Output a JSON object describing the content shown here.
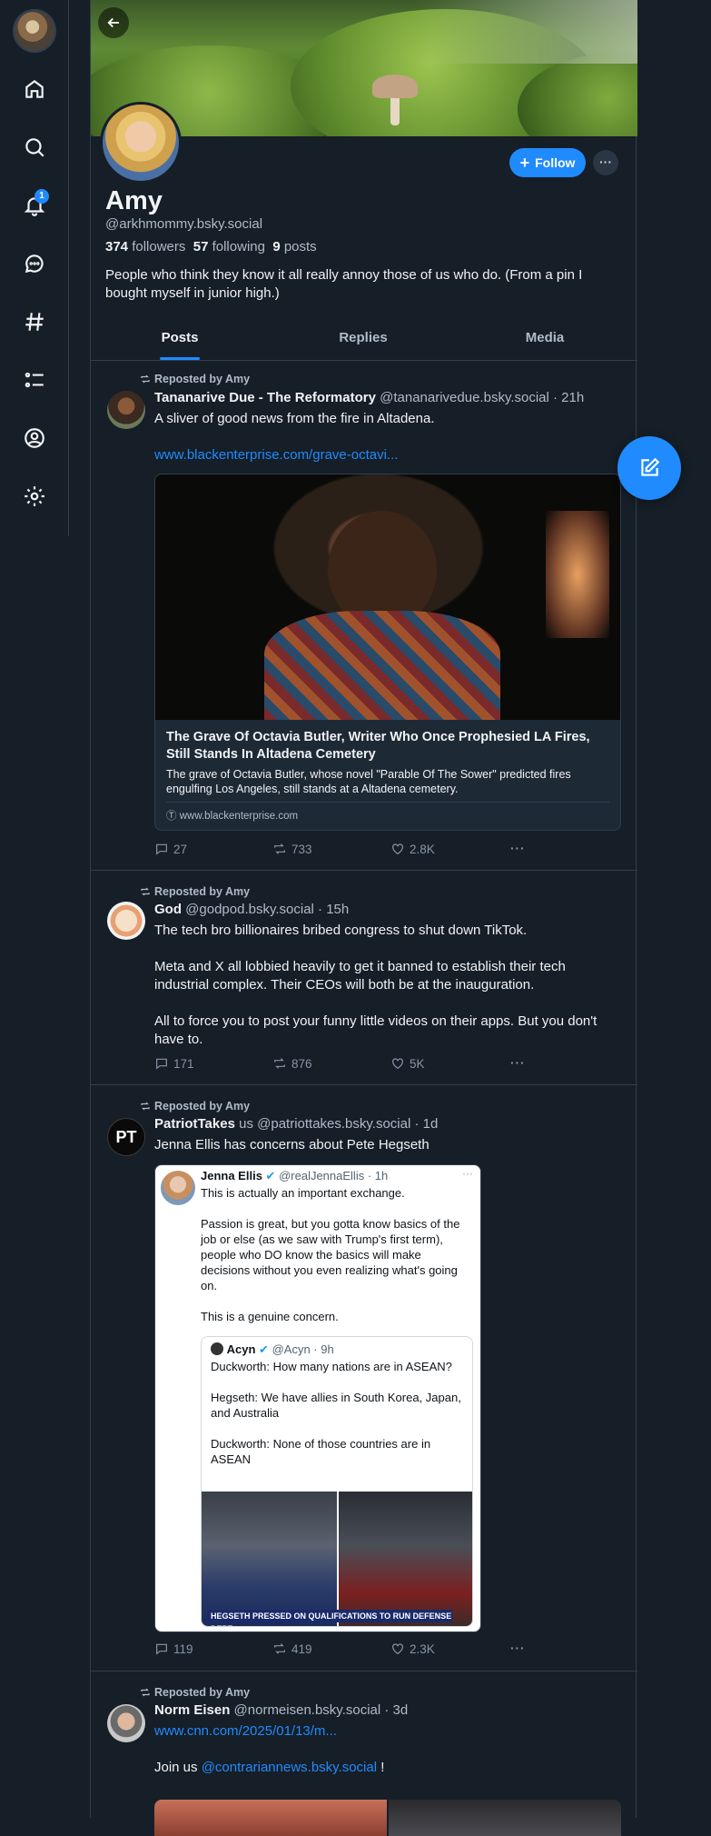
{
  "nav": {
    "notifications_badge": "1",
    "icons": [
      "home-icon",
      "search-icon",
      "bell-icon",
      "chat-icon",
      "hashtag-icon",
      "list-icon",
      "profile-icon",
      "gear-icon"
    ]
  },
  "profile": {
    "name": "Amy",
    "handle": "@arkhmommy.bsky.social",
    "followers_count": "374",
    "followers_label": "followers",
    "following_count": "57",
    "following_label": "following",
    "posts_count": "9",
    "posts_label": "posts",
    "bio": "People who think they know it all really annoy those of us who do. (From a pin I bought myself in junior high.)",
    "follow_label": "Follow",
    "more_label": "···"
  },
  "tabs": [
    "Posts",
    "Replies",
    "Media"
  ],
  "active_tab": "Posts",
  "posts": [
    {
      "reposted_by": "Reposted by Amy",
      "author": "Tananarive Due - The Reformatory",
      "handle": "@tananarivedue.bsky.social",
      "time": "· 21h",
      "text": "A sliver of good news from the fire in Altadena.",
      "link": "www.blackenterprise.com/grave-octavi...",
      "card": {
        "title": "The Grave Of Octavia Butler, Writer Who Once Prophesied LA Fires, Still Stands In Altadena Cemetery",
        "description": "The grave of Octavia Butler, whose novel \"Parable Of The Sower\" predicted fires engulfing Los Angeles, still stands at a Altadena cemetery.",
        "domain": "www.blackenterprise.com"
      },
      "replies": "27",
      "reposts": "733",
      "likes": "2.8K"
    },
    {
      "reposted_by": "Reposted by Amy",
      "author": "God",
      "handle": "@godpod.bsky.social",
      "time": "· 15h",
      "text": "The tech bro billionaires bribed congress to shut down TikTok.\n\nMeta and X all lobbied heavily to get it banned to establish their tech industrial complex. Their CEOs will both be at the inauguration.\n\nAll to force you to post your funny little videos on their apps. But you don't have to.",
      "replies": "171",
      "reposts": "876",
      "likes": "5K"
    },
    {
      "reposted_by": "Reposted by Amy",
      "author": "PatriotTakes",
      "author_flag": "us",
      "avatar_text": "PT",
      "handle": "@patriottakes.bsky.social",
      "time": "· 1d",
      "text": "Jenna Ellis has concerns about Pete Hegseth",
      "embed": {
        "author": "Jenna Ellis",
        "handle": "@realJennaEllis · 1h",
        "text": "This is actually an important exchange.\n\nPassion is great, but you gotta know basics of the job or else (as we saw with Trump's first term), people who DO know the basics will make decisions without you even realizing what's going on.\n\nThis is a genuine concern.",
        "quote_author": "Acyn",
        "quote_handle": "@Acyn · 9h",
        "quote_text": "Duckworth: How many nations are in ASEAN?\n\nHegseth: We have allies in South Korea, Japan, and Australia\n\nDuckworth: None of those countries are in ASEAN",
        "chyron": "HEGSETH PRESSED ON QUALIFICATIONS TO RUN DEFENSE DEPT."
      },
      "replies": "119",
      "reposts": "419",
      "likes": "2.3K"
    },
    {
      "reposted_by": "Reposted by Amy",
      "author": "Norm Eisen",
      "handle": "@normeisen.bsky.social",
      "time": "· 3d",
      "link": "www.cnn.com/2025/01/13/m...",
      "text_prefix": "Join us ",
      "mention": "@contrariannews.bsky.social",
      "text_suffix": " !"
    }
  ],
  "colors": {
    "accent": "#208bfe",
    "background": "#161e27",
    "border": "#2e4052",
    "muted": "#aebbc9"
  }
}
